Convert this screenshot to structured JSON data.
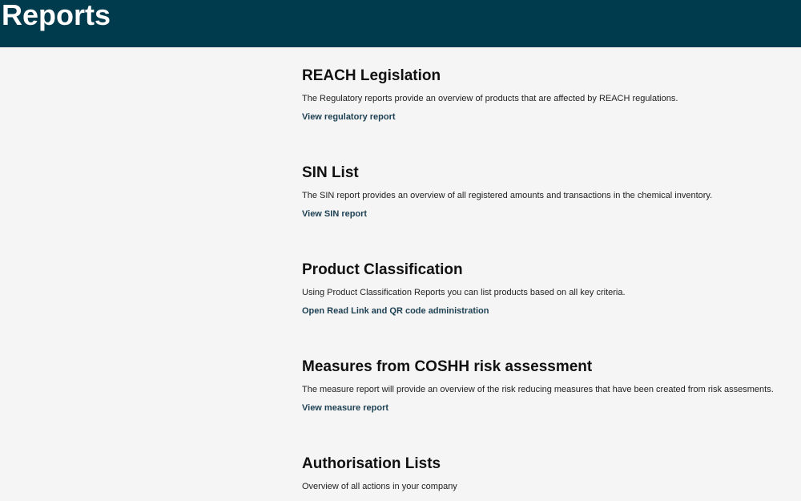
{
  "header": {
    "title": "Reports"
  },
  "sections": [
    {
      "title": "REACH Legislation",
      "description": "The Regulatory reports provide an overview of products that are affected by REACH regulations.",
      "link": "View regulatory report"
    },
    {
      "title": "SIN List",
      "description": "The SIN report provides an overview of all registered amounts and transactions in the chemical inventory.",
      "link": "View SIN report"
    },
    {
      "title": "Product Classification",
      "description": "Using Product Classification Reports you can list products based on all key criteria.",
      "link": "Open Read Link and QR code administration"
    },
    {
      "title": "Measures from COSHH risk assessment",
      "description": "The measure report will provide an overview of the risk reducing measures that have been created from risk assesments.",
      "link": "View measure report"
    },
    {
      "title": "Authorisation Lists",
      "description": "Overview of all actions in your company"
    }
  ]
}
